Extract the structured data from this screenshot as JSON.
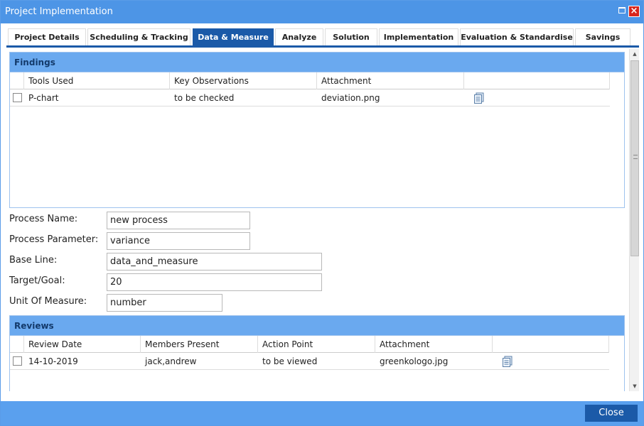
{
  "window": {
    "title": "Project Implementation"
  },
  "tabs": [
    {
      "label": "Project Details"
    },
    {
      "label": "Scheduling & Tracking"
    },
    {
      "label": "Data & Measure"
    },
    {
      "label": "Analyze"
    },
    {
      "label": "Solution"
    },
    {
      "label": "Implementation"
    },
    {
      "label": "Evaluation & Standardise"
    },
    {
      "label": "Savings"
    }
  ],
  "active_tab": "Data & Measure",
  "findings": {
    "title": "Findings",
    "columns": [
      "Tools Used",
      "Key Observations",
      "Attachment",
      ""
    ],
    "rows": [
      {
        "tool": "P-chart",
        "observation": "to be checked",
        "attachment": "deviation.png",
        "icon": "document-icon"
      }
    ]
  },
  "form": {
    "process_name": {
      "label": "Process Name:",
      "value": "new process"
    },
    "process_parameter": {
      "label": "Process Parameter:",
      "value": "variance"
    },
    "base_line": {
      "label": "Base Line:",
      "value": "data_and_measure"
    },
    "target_goal": {
      "label": "Target/Goal:",
      "value": "20"
    },
    "unit_of_measure": {
      "label": "Unit Of Measure:",
      "value": "number"
    }
  },
  "reviews": {
    "title": "Reviews",
    "columns": [
      "Review Date",
      "Members Present",
      "Action Point",
      "Attachment",
      ""
    ],
    "rows": [
      {
        "date": "14-10-2019",
        "members": "jack,andrew",
        "action": "to be viewed",
        "attachment": "greenkologo.jpg",
        "icon": "document-icon"
      }
    ]
  },
  "footer": {
    "close_label": "Close"
  },
  "colors": {
    "title_bar": "#4d95e6",
    "tab_active": "#1b5aa8",
    "panel_header": "#6aa9ef",
    "footer": "#5aa0ee",
    "close_button": "#1b5aa8"
  }
}
